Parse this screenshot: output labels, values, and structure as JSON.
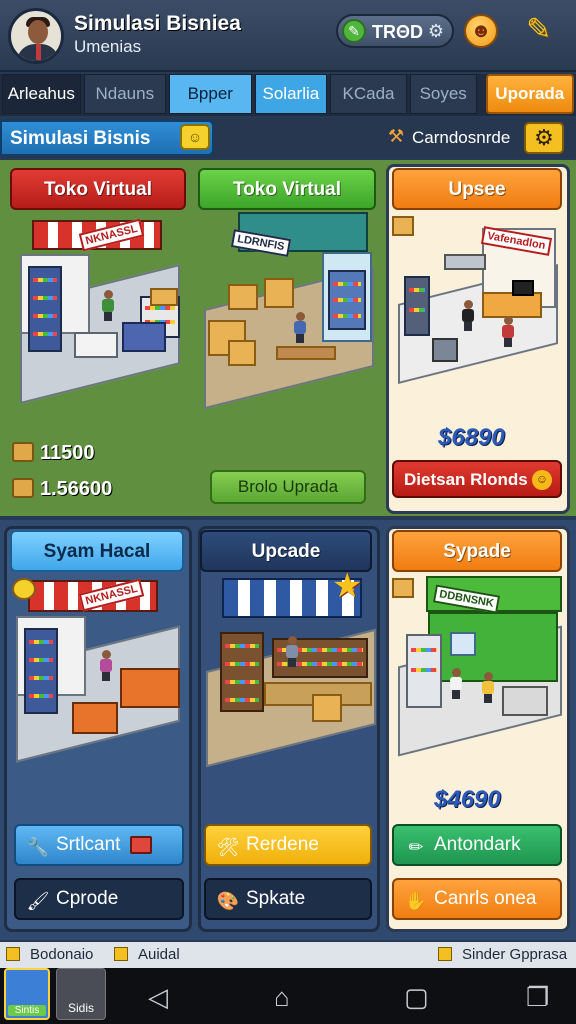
{
  "header": {
    "title": "Simulasi Bisniea",
    "subtitle": "Umenias",
    "currency_label": "TRΘD",
    "icons": [
      "avatar",
      "leaf-icon",
      "gear-icon",
      "smiley-icon",
      "pin-icon"
    ]
  },
  "tabs": [
    {
      "label": "Arleahus"
    },
    {
      "label": "Ndauns"
    },
    {
      "label": "Bpper"
    },
    {
      "label": "Solarlia"
    },
    {
      "label": "KCada"
    },
    {
      "label": "Soyes"
    },
    {
      "label": "Uporada"
    }
  ],
  "section": {
    "title": "Simulasi Bisnis",
    "right_label": "Carndosnrde"
  },
  "cards": [
    {
      "title": "Toko Virtual"
    },
    {
      "title": "Toko Virtual"
    },
    {
      "title": "Upsee"
    },
    {
      "title": "Syam Hacal"
    },
    {
      "title": "Upcade"
    },
    {
      "title": "Sypade"
    }
  ],
  "store_signs": [
    "NKNASSL",
    "LDRNFIS",
    "NKNASSL",
    "Vafenadlon",
    "DDBNSNK"
  ],
  "stats": [
    {
      "value": "11500"
    },
    {
      "value": "1.56600"
    }
  ],
  "buttons": {
    "green": "Brolo Uprada",
    "red": "Dietsan Rlonds",
    "b1": "Srtlcant",
    "b2": "Cprode",
    "b3": "Rerdene",
    "b4": "Spkate",
    "b5": "Antondark",
    "b6": "Canrls onea"
  },
  "prices": [
    "$6890",
    "$4690"
  ],
  "footer": [
    "Bodonaio",
    "Auidal",
    "Sinder Gpprasa"
  ],
  "apps": [
    "Sintis",
    "Sidis"
  ]
}
